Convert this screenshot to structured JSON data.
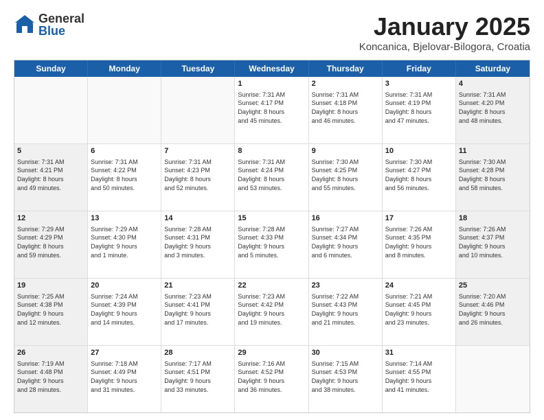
{
  "header": {
    "logo_general": "General",
    "logo_blue": "Blue",
    "title": "January 2025",
    "subtitle": "Koncanica, Bjelovar-Bilogora, Croatia"
  },
  "calendar": {
    "days": [
      "Sunday",
      "Monday",
      "Tuesday",
      "Wednesday",
      "Thursday",
      "Friday",
      "Saturday"
    ],
    "rows": [
      [
        {
          "day": "",
          "text": "",
          "empty": true
        },
        {
          "day": "",
          "text": "",
          "empty": true
        },
        {
          "day": "",
          "text": "",
          "empty": true
        },
        {
          "day": "1",
          "text": "Sunrise: 7:31 AM\nSunset: 4:17 PM\nDaylight: 8 hours\nand 45 minutes."
        },
        {
          "day": "2",
          "text": "Sunrise: 7:31 AM\nSunset: 4:18 PM\nDaylight: 8 hours\nand 46 minutes."
        },
        {
          "day": "3",
          "text": "Sunrise: 7:31 AM\nSunset: 4:19 PM\nDaylight: 8 hours\nand 47 minutes."
        },
        {
          "day": "4",
          "text": "Sunrise: 7:31 AM\nSunset: 4:20 PM\nDaylight: 8 hours\nand 48 minutes.",
          "shaded": true
        }
      ],
      [
        {
          "day": "5",
          "text": "Sunrise: 7:31 AM\nSunset: 4:21 PM\nDaylight: 8 hours\nand 49 minutes.",
          "shaded": true
        },
        {
          "day": "6",
          "text": "Sunrise: 7:31 AM\nSunset: 4:22 PM\nDaylight: 8 hours\nand 50 minutes."
        },
        {
          "day": "7",
          "text": "Sunrise: 7:31 AM\nSunset: 4:23 PM\nDaylight: 8 hours\nand 52 minutes."
        },
        {
          "day": "8",
          "text": "Sunrise: 7:31 AM\nSunset: 4:24 PM\nDaylight: 8 hours\nand 53 minutes."
        },
        {
          "day": "9",
          "text": "Sunrise: 7:30 AM\nSunset: 4:25 PM\nDaylight: 8 hours\nand 55 minutes."
        },
        {
          "day": "10",
          "text": "Sunrise: 7:30 AM\nSunset: 4:27 PM\nDaylight: 8 hours\nand 56 minutes."
        },
        {
          "day": "11",
          "text": "Sunrise: 7:30 AM\nSunset: 4:28 PM\nDaylight: 8 hours\nand 58 minutes.",
          "shaded": true
        }
      ],
      [
        {
          "day": "12",
          "text": "Sunrise: 7:29 AM\nSunset: 4:29 PM\nDaylight: 8 hours\nand 59 minutes.",
          "shaded": true
        },
        {
          "day": "13",
          "text": "Sunrise: 7:29 AM\nSunset: 4:30 PM\nDaylight: 9 hours\nand 1 minute."
        },
        {
          "day": "14",
          "text": "Sunrise: 7:28 AM\nSunset: 4:31 PM\nDaylight: 9 hours\nand 3 minutes."
        },
        {
          "day": "15",
          "text": "Sunrise: 7:28 AM\nSunset: 4:33 PM\nDaylight: 9 hours\nand 5 minutes."
        },
        {
          "day": "16",
          "text": "Sunrise: 7:27 AM\nSunset: 4:34 PM\nDaylight: 9 hours\nand 6 minutes."
        },
        {
          "day": "17",
          "text": "Sunrise: 7:26 AM\nSunset: 4:35 PM\nDaylight: 9 hours\nand 8 minutes."
        },
        {
          "day": "18",
          "text": "Sunrise: 7:26 AM\nSunset: 4:37 PM\nDaylight: 9 hours\nand 10 minutes.",
          "shaded": true
        }
      ],
      [
        {
          "day": "19",
          "text": "Sunrise: 7:25 AM\nSunset: 4:38 PM\nDaylight: 9 hours\nand 12 minutes.",
          "shaded": true
        },
        {
          "day": "20",
          "text": "Sunrise: 7:24 AM\nSunset: 4:39 PM\nDaylight: 9 hours\nand 14 minutes."
        },
        {
          "day": "21",
          "text": "Sunrise: 7:23 AM\nSunset: 4:41 PM\nDaylight: 9 hours\nand 17 minutes."
        },
        {
          "day": "22",
          "text": "Sunrise: 7:23 AM\nSunset: 4:42 PM\nDaylight: 9 hours\nand 19 minutes."
        },
        {
          "day": "23",
          "text": "Sunrise: 7:22 AM\nSunset: 4:43 PM\nDaylight: 9 hours\nand 21 minutes."
        },
        {
          "day": "24",
          "text": "Sunrise: 7:21 AM\nSunset: 4:45 PM\nDaylight: 9 hours\nand 23 minutes."
        },
        {
          "day": "25",
          "text": "Sunrise: 7:20 AM\nSunset: 4:46 PM\nDaylight: 9 hours\nand 26 minutes.",
          "shaded": true
        }
      ],
      [
        {
          "day": "26",
          "text": "Sunrise: 7:19 AM\nSunset: 4:48 PM\nDaylight: 9 hours\nand 28 minutes.",
          "shaded": true
        },
        {
          "day": "27",
          "text": "Sunrise: 7:18 AM\nSunset: 4:49 PM\nDaylight: 9 hours\nand 31 minutes."
        },
        {
          "day": "28",
          "text": "Sunrise: 7:17 AM\nSunset: 4:51 PM\nDaylight: 9 hours\nand 33 minutes."
        },
        {
          "day": "29",
          "text": "Sunrise: 7:16 AM\nSunset: 4:52 PM\nDaylight: 9 hours\nand 36 minutes."
        },
        {
          "day": "30",
          "text": "Sunrise: 7:15 AM\nSunset: 4:53 PM\nDaylight: 9 hours\nand 38 minutes."
        },
        {
          "day": "31",
          "text": "Sunrise: 7:14 AM\nSunset: 4:55 PM\nDaylight: 9 hours\nand 41 minutes."
        },
        {
          "day": "",
          "text": "",
          "empty": true,
          "shaded": true
        }
      ]
    ]
  }
}
